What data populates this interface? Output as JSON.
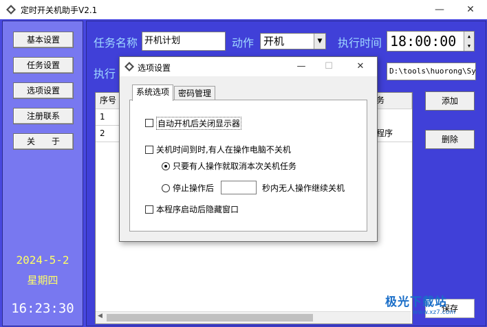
{
  "window": {
    "title": "定时开关机助手V2.1",
    "minimize": "—",
    "maximize": "☐",
    "close": "✕"
  },
  "nav": {
    "items": [
      {
        "label": "基本设置"
      },
      {
        "label": "任务设置"
      },
      {
        "label": "选项设置"
      },
      {
        "label": "注册联系"
      },
      {
        "label": "关　　于"
      }
    ]
  },
  "clockpanel": {
    "date": "2024-5-2",
    "weekday": "星期四",
    "time": "16:23:30"
  },
  "task": {
    "name_label": "任务名称",
    "name_value": "开机计划",
    "action_label": "动作",
    "action_value": "开机",
    "time_label": "执行时间",
    "time_value": "18:00:00",
    "exec_label": "执行",
    "path_value": "D:\\tools\\huorong\\Sysd"
  },
  "table": {
    "headers": [
      "序号",
      "任务"
    ],
    "rows": [
      {
        "index": "1",
        "task": ""
      },
      {
        "index": "2",
        "task": "行程序"
      }
    ]
  },
  "actions": {
    "add": "添加",
    "delete": "删除",
    "save": "保存"
  },
  "dialog": {
    "title": "选项设置",
    "minimize": "—",
    "maximize": "☐",
    "close": "✕",
    "tabs": [
      "系统选项",
      "密码管理"
    ],
    "options": {
      "auto_off_monitor": "自动开机后关闭显示器",
      "no_shutdown_when_in_use": "关机时间到时,有人在操作电脑不关机",
      "cancel_if_used": "只要有人操作就取消本次关机任务",
      "resume_label_pre": "停止操作后",
      "resume_label_post": "秒内无人操作继续关机",
      "hide_on_start": "本程序启动后隐藏窗口"
    }
  },
  "watermark": {
    "text": "极光下载站",
    "url": "www.xz7.com"
  }
}
